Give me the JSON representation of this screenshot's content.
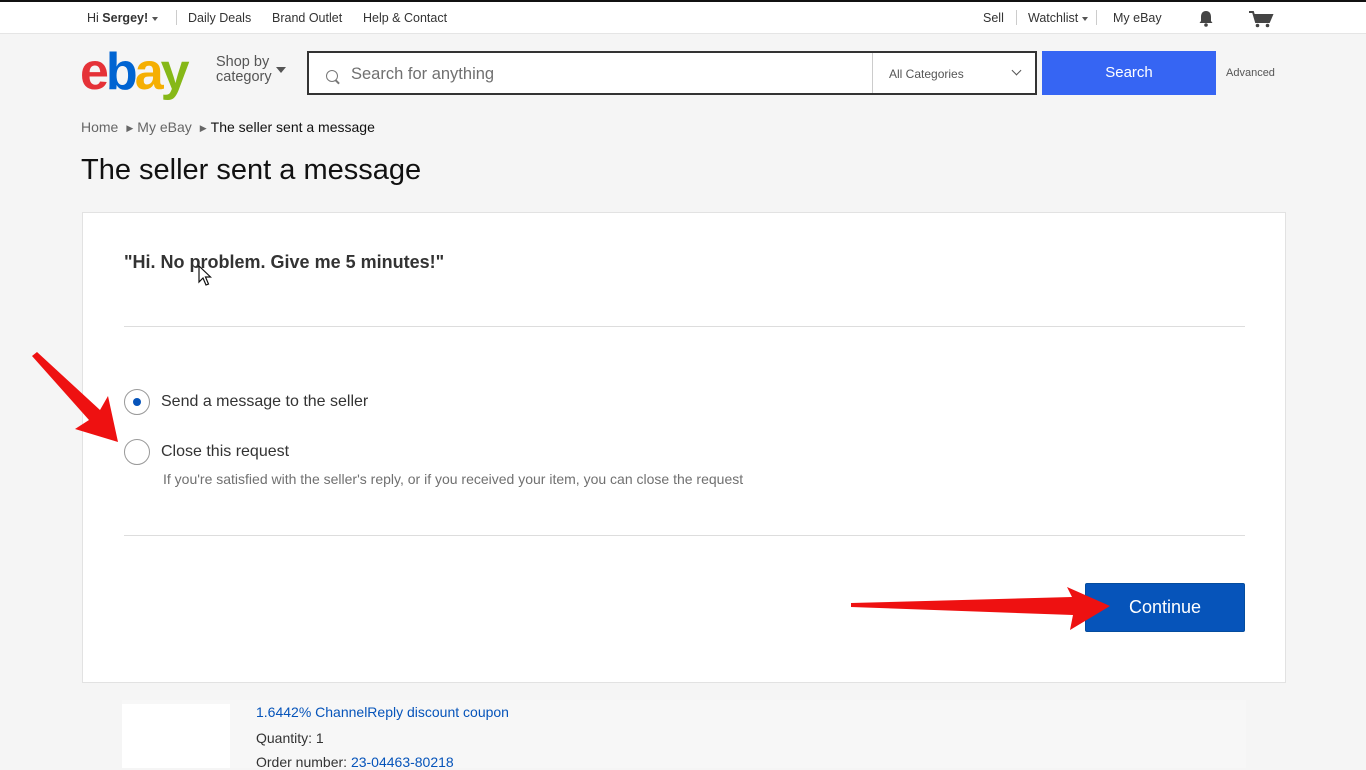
{
  "topbar": {
    "greeting_prefix": "Hi ",
    "user_name": "Sergey!",
    "links": [
      "Daily Deals",
      "Brand Outlet",
      "Help & Contact"
    ],
    "sell": "Sell",
    "watchlist": "Watchlist",
    "my_ebay": "My eBay",
    "icons": [
      "bell-icon",
      "cart-icon"
    ]
  },
  "header": {
    "logo": [
      "e",
      "b",
      "a",
      "y"
    ],
    "logo_colors": [
      "#e53238",
      "#0064d2",
      "#f5af02",
      "#86b817"
    ],
    "shop_by_line1": "Shop by",
    "shop_by_line2": "category",
    "search_placeholder": "Search for anything",
    "category": "All Categories",
    "search_button": "Search",
    "search_button_color": "#3665f3",
    "advanced": "Advanced"
  },
  "breadcrumb": {
    "home": "Home",
    "my_ebay": "My eBay",
    "current": "The seller sent a message"
  },
  "page_title": "The seller sent a message",
  "message": {
    "quote": "\"Hi. No problem. Give me 5 minutes!\""
  },
  "options": {
    "send_label": "Send a message to the seller",
    "send_checked": true,
    "close_label": "Close this request",
    "close_checked": false,
    "close_help": "If you're satisfied with the seller's reply, or if you received your item, you can close the request"
  },
  "continue_button": {
    "label": "Continue",
    "color": "#0654ba"
  },
  "item": {
    "title": "1.6442% ChannelReply discount coupon",
    "quantity": "Quantity: 1",
    "order_label": "Order number: ",
    "order_number": "23-04463-80218"
  },
  "annotations": {
    "arrow_color": "#ee1111"
  }
}
